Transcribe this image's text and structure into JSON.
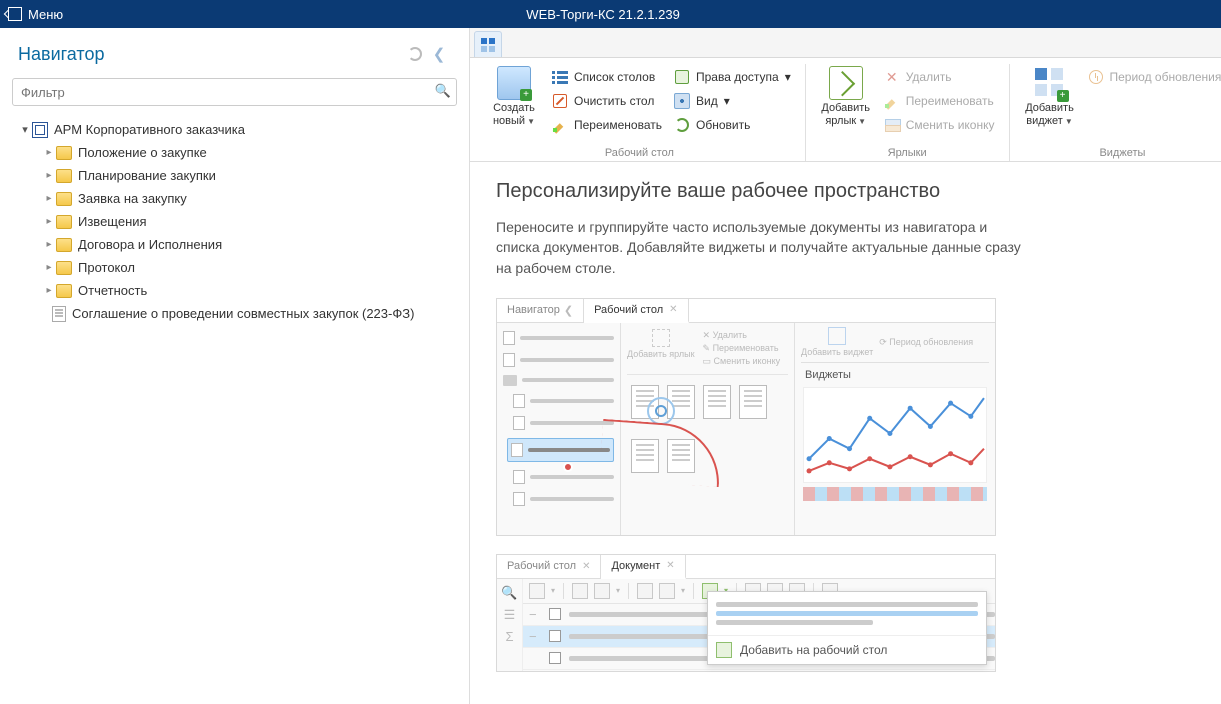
{
  "app": {
    "menu": "Меню",
    "title": "WEB-Торги-КС 21.2.1.239"
  },
  "sidebar": {
    "title": "Навигатор",
    "filter_placeholder": "Фильтр",
    "root": {
      "label": "АРМ Корпоративного заказчика"
    },
    "items": [
      {
        "label": "Положение о закупке"
      },
      {
        "label": "Планирование закупки"
      },
      {
        "label": "Заявка на закупку"
      },
      {
        "label": "Извещения"
      },
      {
        "label": "Договора и Исполнения"
      },
      {
        "label": "Протокол"
      },
      {
        "label": "Отчетность"
      }
    ],
    "leaf": {
      "label": "Соглашение о проведении совместных закупок (223-ФЗ)"
    }
  },
  "ribbon": {
    "groups": {
      "desktop": {
        "title": "Рабочий стол",
        "create": "Создать новый",
        "list": "Список столов",
        "clear": "Очистить стол",
        "rename": "Переименовать",
        "access": "Права доступа",
        "view": "Вид",
        "refresh": "Обновить"
      },
      "shortcuts": {
        "title": "Ярлыки",
        "add": "Добавить ярлык",
        "delete": "Удалить",
        "rename": "Переименовать",
        "change_icon": "Сменить иконку"
      },
      "widgets": {
        "title": "Виджеты",
        "add": "Добавить виджет",
        "period": "Период обновления"
      }
    }
  },
  "workspace": {
    "title": "Персонализируйте ваше рабочее пространство",
    "desc": "Переносите и группируйте часто используемые документы из навигатора и списка документов. Добавляйте виджеты и получайте актуальные данные сразу на рабочем столе."
  },
  "illus1": {
    "tabs": {
      "nav": "Навигатор",
      "desk": "Рабочий стол"
    },
    "mid": {
      "add_shortcut": "Добавить ярлык",
      "delete": "Удалить",
      "rename": "Переименовать",
      "change_icon": "Сменить иконку"
    },
    "right": {
      "add_widget": "Добавить виджет",
      "period": "Период обновления",
      "widgets_title": "Виджеты"
    }
  },
  "illus2": {
    "tabs": {
      "desk": "Рабочий стол",
      "doc": "Документ"
    },
    "context": {
      "add_to_desktop": "Добавить на рабочий стол"
    }
  }
}
